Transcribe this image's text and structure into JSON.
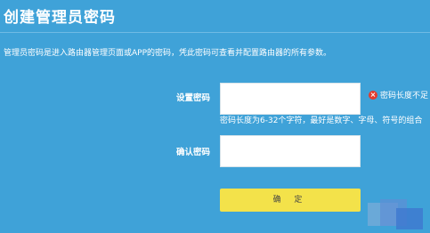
{
  "page": {
    "title": "创建管理员密码",
    "description": "管理员密码是进入路由器管理页面或APP的密码，凭此密码可查看并配置路由器的所有参数。"
  },
  "form": {
    "set_password_label": "设置密码",
    "set_password_value": "",
    "error_message": "密码长度不足",
    "hint": "密码长度为6-32个字符，最好是数字、字母、符号的组合",
    "confirm_password_label": "确认密码",
    "confirm_password_value": "",
    "confirm_button_label": "确 定"
  },
  "colors": {
    "background": "#3fa2d8",
    "button": "#f3e24a",
    "error_icon": "#e23b2f"
  },
  "icons": {
    "error": "error-x-icon"
  }
}
